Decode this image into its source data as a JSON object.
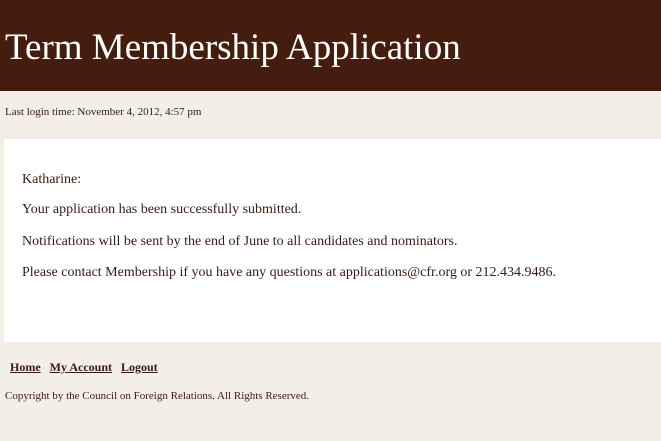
{
  "header": {
    "title": "Term Membership Application"
  },
  "session": {
    "last_login": "Last login time: November 4, 2012, 4:57 pm"
  },
  "message": {
    "greeting": "Katharine:",
    "line1": "Your application has been successfully submitted.",
    "line2": "Notifications will be sent by the end of June to all candidates and nominators.",
    "line3": "Please contact Membership if you have any questions at applications@cfr.org or 212.434.9486."
  },
  "footer": {
    "nav": {
      "home": "Home",
      "my_account": "My Account",
      "logout": "Logout"
    },
    "copyright": "Copyright by the Council on Foreign Relations. All Rights Reserved."
  },
  "colors": {
    "header_bg": "#451d0f",
    "page_bg": "#f3efe6",
    "text": "#3a1a10"
  }
}
